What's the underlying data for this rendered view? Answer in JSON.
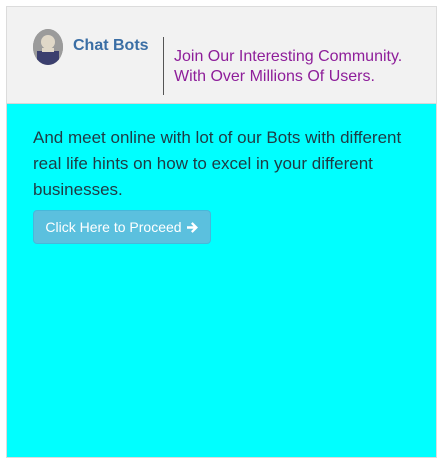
{
  "header": {
    "brand": "Chat Bots",
    "avatar_icon": "bot-avatar-icon",
    "tagline_line1": "Join Our Interesting Community.",
    "tagline_line2": "With Over Millions Of Users."
  },
  "main": {
    "text": "And meet online with lot of our Bots with different real life hints on how to excel in your different businesses.",
    "button_label": "Click Here to Proceed",
    "button_icon": "arrow-right-icon"
  },
  "colors": {
    "content_background": "#00ffff",
    "header_background": "#f2f2f2",
    "brand": "#3a6ea5",
    "tagline": "#8e1e9a",
    "button": "#5bc0de"
  }
}
